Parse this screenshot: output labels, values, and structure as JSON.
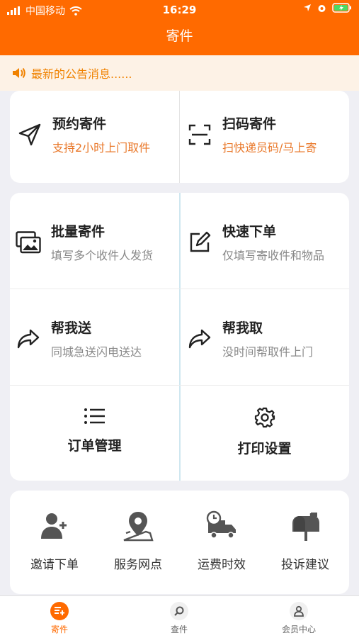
{
  "status_bar": {
    "carrier": "中国移动",
    "time": "16:29"
  },
  "navbar": {
    "title": "寄件"
  },
  "notice": {
    "text": "最新的公告消息......"
  },
  "card1": [
    {
      "icon": "paper-plane-icon",
      "title": "预约寄件",
      "subtitle": "支持2小时上门取件"
    },
    {
      "icon": "scan-icon",
      "title": "扫码寄件",
      "subtitle": "扫快递员码/马上寄"
    }
  ],
  "card2": {
    "rows": [
      [
        {
          "icon": "images-icon",
          "title": "批量寄件",
          "subtitle": "填写多个收件人发货"
        },
        {
          "icon": "edit-icon",
          "title": "快速下单",
          "subtitle": "仅填写寄收件和物品"
        }
      ],
      [
        {
          "icon": "share-arrow-icon",
          "title": "帮我送",
          "subtitle": "同城急送闪电送达"
        },
        {
          "icon": "share-arrow-icon",
          "title": "帮我取",
          "subtitle": "没时间帮取件上门"
        }
      ]
    ],
    "bottom": [
      {
        "icon": "list-icon",
        "label": "订单管理"
      },
      {
        "icon": "gear-icon",
        "label": "打印设置"
      }
    ]
  },
  "tools": [
    {
      "icon": "add-user-icon",
      "label": "邀请下单"
    },
    {
      "icon": "location-map-icon",
      "label": "服务网点"
    },
    {
      "icon": "delivery-truck-clock-icon",
      "label": "运费时效"
    },
    {
      "icon": "mailbox-icon",
      "label": "投诉建议"
    }
  ],
  "tabbar": {
    "items": [
      {
        "icon": "send-package-icon",
        "label": "寄件",
        "active": true
      },
      {
        "icon": "search-icon",
        "label": "查件",
        "active": false
      },
      {
        "icon": "user-icon",
        "label": "会员中心",
        "active": false
      }
    ],
    "active_color": "#ff6a00"
  },
  "colors": {
    "brand": "#ff6a00",
    "notice_text": "#f08200",
    "subtitle_orange": "#e9782a"
  }
}
